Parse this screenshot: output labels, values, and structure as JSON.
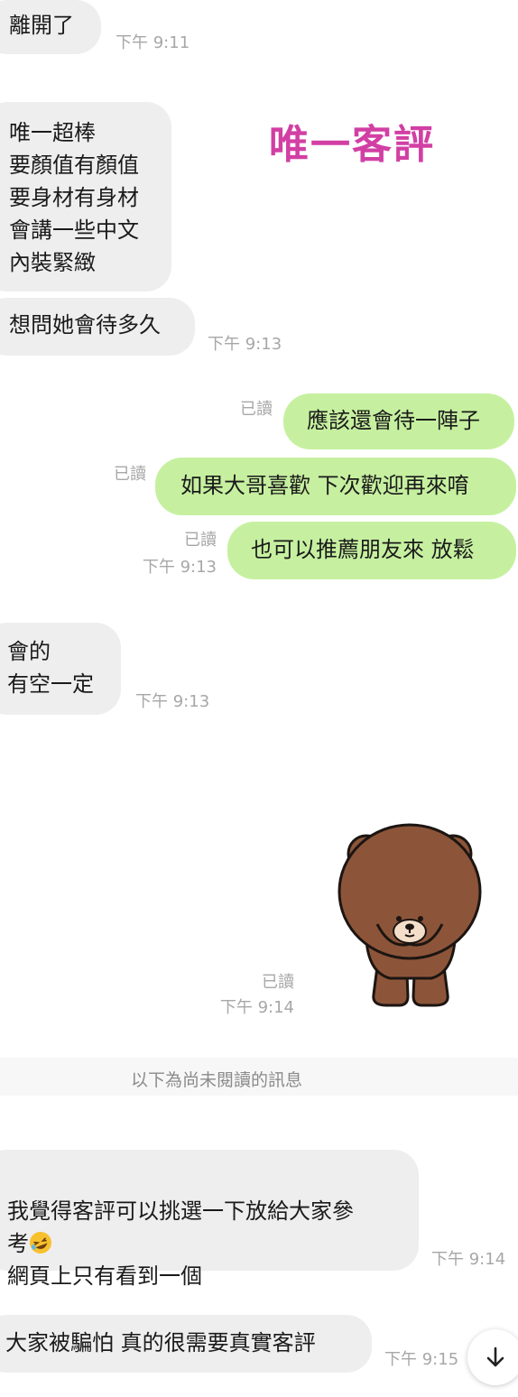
{
  "messages": [
    {
      "text": "離開了",
      "time": "下午 9:11"
    },
    {
      "text": "唯一超棒\n要顏值有顏值\n要身材有身材\n會講一些中文\n內裝緊緻"
    },
    {
      "text": "想問她會待多久",
      "time": "下午 9:13"
    },
    {
      "text": "應該還會待一陣子",
      "read": "已讀"
    },
    {
      "text": "如果大哥喜歡 下次歡迎再來唷",
      "read": "已讀"
    },
    {
      "text": "也可以推薦朋友來 放鬆",
      "read": "已讀",
      "time": "下午 9:13"
    },
    {
      "text": "會的\n有空一定",
      "time": "下午 9:13"
    },
    {
      "read": "已讀",
      "time": "下午 9:14"
    },
    {
      "text_a": "我覺得客評可以挑選一下放給大家參\n考",
      "text_b": "\n網頁上只有看到一個",
      "time": "下午 9:14"
    },
    {
      "text": "大家被騙怕  真的很需要真實客評",
      "time": "下午 9:15"
    }
  ],
  "overlay": {
    "title": "唯一客評"
  },
  "unread_divider": "以下為尚未閱讀的訊息",
  "sticker": {
    "icon": "brown-bear-sticker"
  },
  "scroll_button": {
    "icon": "arrow-down-icon"
  },
  "colors": {
    "incoming": "#eeeeee",
    "outgoing": "#c6f0a0",
    "overlay_title": "#d23fa4"
  }
}
